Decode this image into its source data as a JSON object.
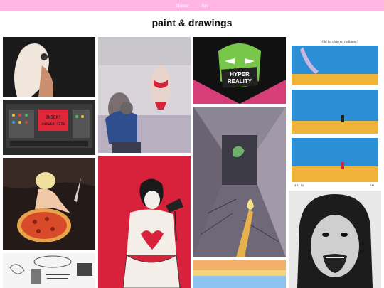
{
  "nav": {
    "home": "Home",
    "art": "Art"
  },
  "page": {
    "title": "paint & drawings"
  },
  "artworks": {
    "hyper": {
      "line1": "HYPER",
      "line2": "REALITY"
    },
    "monitor": {
      "line1": "INSERT",
      "line2": "ANSWER HERE"
    },
    "comic": {
      "caption": "Chi ha visto mi radiante?",
      "date": "3.11.13",
      "initials": "FM"
    }
  },
  "colors": {
    "nav_bg": "#ffb6e6",
    "nav_text": "#ffffff",
    "accent_red": "#d8213a"
  }
}
